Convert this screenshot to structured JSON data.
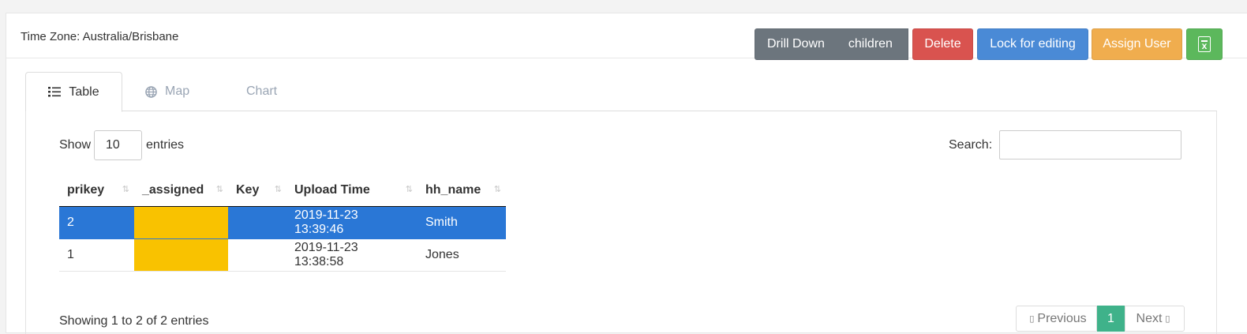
{
  "header": {
    "timezone": "Time Zone: Australia/Brisbane",
    "buttons": {
      "drill_down": "Drill Down",
      "children": "children",
      "delete": "Delete",
      "lock": "Lock for editing",
      "assign": "Assign User",
      "excel_icon": "excel-icon"
    }
  },
  "colors": {
    "drill": "#6c757d",
    "delete": "#d9534f",
    "lock": "#4a8ad6",
    "assign": "#f0ad4e",
    "excel": "#5cb85c",
    "selected_row": "#2a77d6",
    "assigned_highlight": "#f9c200",
    "current_page": "#3fb28a"
  },
  "tabs": [
    {
      "label": "Table",
      "icon": "list-icon",
      "active": true
    },
    {
      "label": "Map",
      "icon": "globe-icon",
      "active": false
    },
    {
      "label": "Chart",
      "icon": "",
      "active": false
    }
  ],
  "controls": {
    "show": "Show",
    "length_value": "10",
    "entries": "entries",
    "search_label": "Search:",
    "search_value": ""
  },
  "table": {
    "columns": [
      "prikey",
      "_assigned",
      "Key",
      "Upload Time",
      "hh_name"
    ],
    "rows": [
      {
        "prikey": "2",
        "assigned": "",
        "key": "",
        "upload": "2019-11-23 13:39:46",
        "hh_name": "Smith",
        "selected": true
      },
      {
        "prikey": "1",
        "assigned": "",
        "key": "",
        "upload": "2019-11-23 13:38:58",
        "hh_name": "Jones",
        "selected": false
      }
    ]
  },
  "footer": {
    "info": "Showing 1 to 2 of 2 entries",
    "prev": "Previous",
    "current": "1",
    "next": "Next"
  }
}
